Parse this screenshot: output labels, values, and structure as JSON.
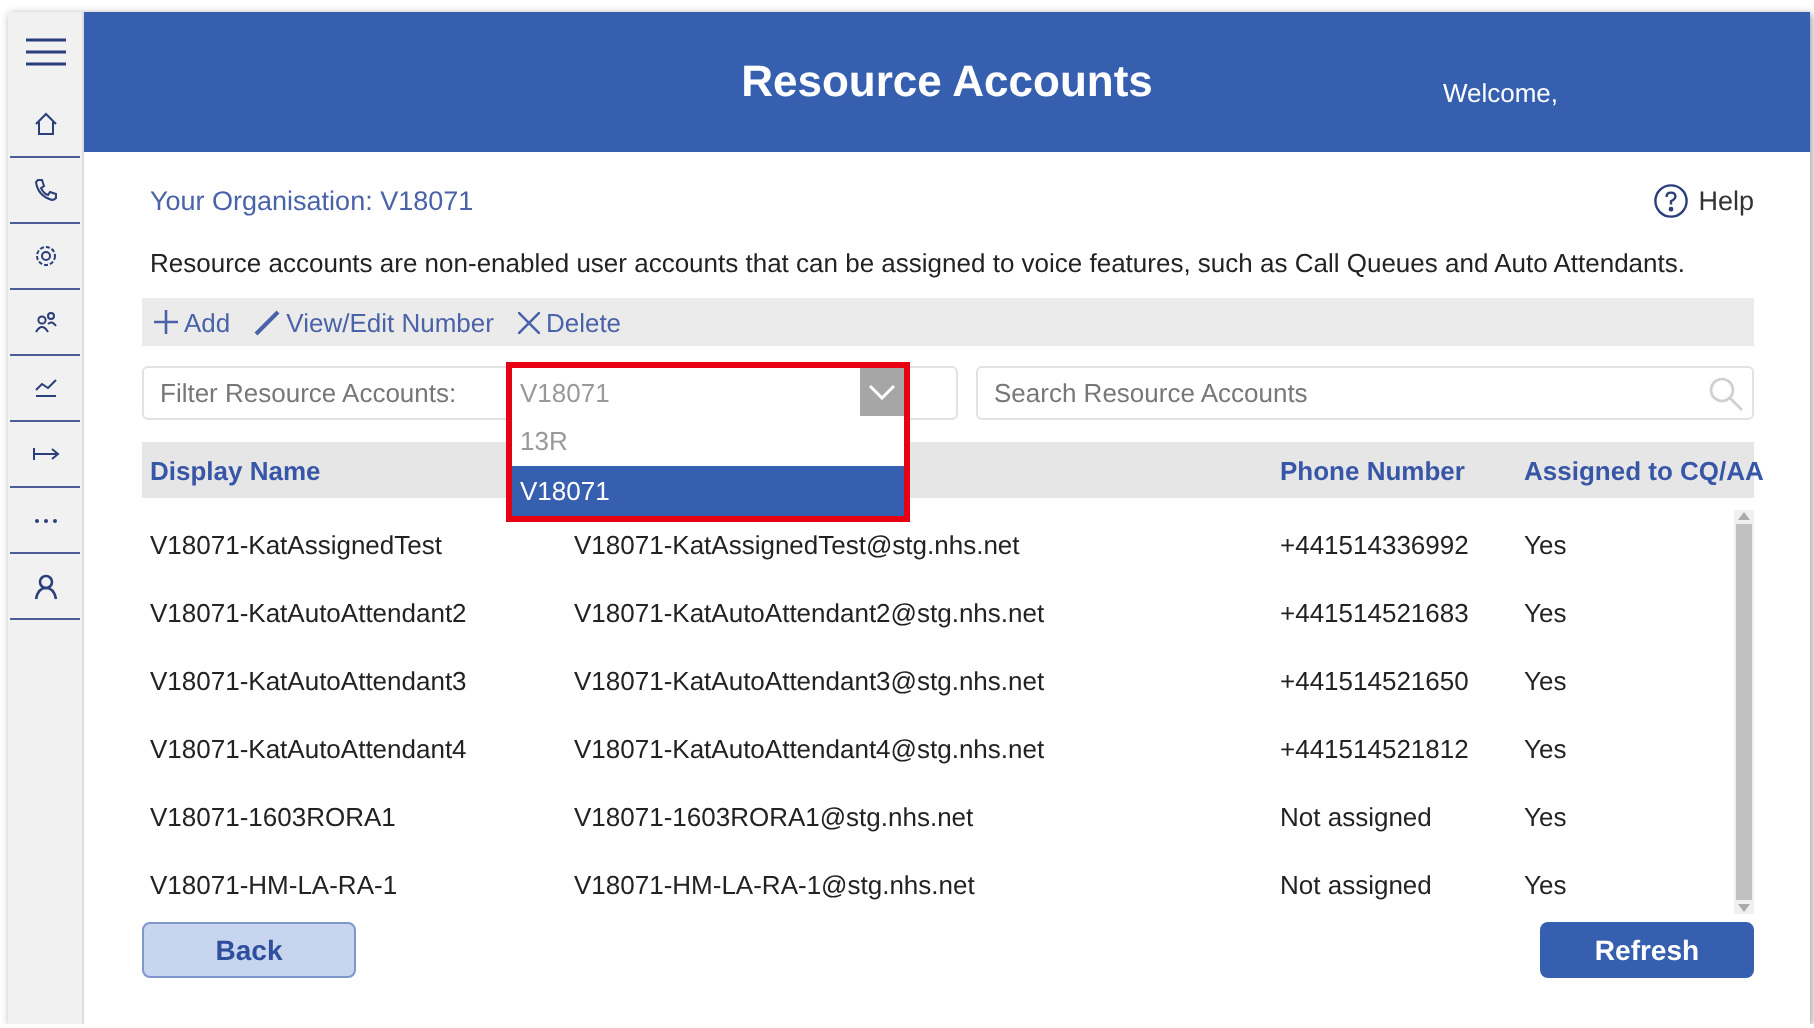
{
  "sidebar": {
    "items": [
      {
        "kind": "menu"
      },
      {
        "kind": "home"
      },
      {
        "kind": "phone"
      },
      {
        "kind": "settings"
      },
      {
        "kind": "people"
      },
      {
        "kind": "chart"
      },
      {
        "kind": "arrow"
      },
      {
        "kind": "more"
      },
      {
        "kind": "person"
      }
    ]
  },
  "header": {
    "title": "Resource Accounts",
    "welcome": "Welcome,"
  },
  "organisation": "Your Organisation: V18071",
  "help": "Help",
  "description": "Resource accounts are non-enabled user accounts that can be assigned to voice features, such as Call Queues and Auto Attendants.",
  "toolbar": [
    {
      "kind": "add",
      "label": "Add"
    },
    {
      "kind": "edit",
      "label": "View/Edit Number"
    },
    {
      "kind": "delete",
      "label": "Delete"
    }
  ],
  "filter": {
    "label": "Filter Resource Accounts:",
    "value": "V18071",
    "expanded": true,
    "options": [
      {
        "label": "13R",
        "selected": false
      },
      {
        "label": "V18071",
        "selected": true
      }
    ]
  },
  "search": {
    "placeholder": "Search Resource Accounts"
  },
  "table": {
    "columns": {
      "display_name": "Display Name",
      "phone_number": "Phone Number",
      "assigned": "Assigned to CQ/AA"
    },
    "rows": [
      {
        "display_name": "V18071-KatAssignedTest",
        "email": "V18071-KatAssignedTest@stg.nhs.net",
        "phone_number": "+441514336992",
        "assigned": "Yes"
      },
      {
        "display_name": "V18071-KatAutoAttendant2",
        "email": "V18071-KatAutoAttendant2@stg.nhs.net",
        "phone_number": "+441514521683",
        "assigned": "Yes"
      },
      {
        "display_name": "V18071-KatAutoAttendant3",
        "email": "V18071-KatAutoAttendant3@stg.nhs.net",
        "phone_number": "+441514521650",
        "assigned": "Yes"
      },
      {
        "display_name": "V18071-KatAutoAttendant4",
        "email": "V18071-KatAutoAttendant4@stg.nhs.net",
        "phone_number": "+441514521812",
        "assigned": "Yes"
      },
      {
        "display_name": "V18071-1603RORA1",
        "email": "V18071-1603RORA1@stg.nhs.net",
        "phone_number": "Not assigned",
        "assigned": "Yes"
      },
      {
        "display_name": "V18071-HM-LA-RA-1",
        "email": "V18071-HM-LA-RA-1@stg.nhs.net",
        "phone_number": "Not assigned",
        "assigned": "Yes"
      }
    ]
  },
  "buttons": {
    "back": "Back",
    "refresh": "Refresh"
  }
}
